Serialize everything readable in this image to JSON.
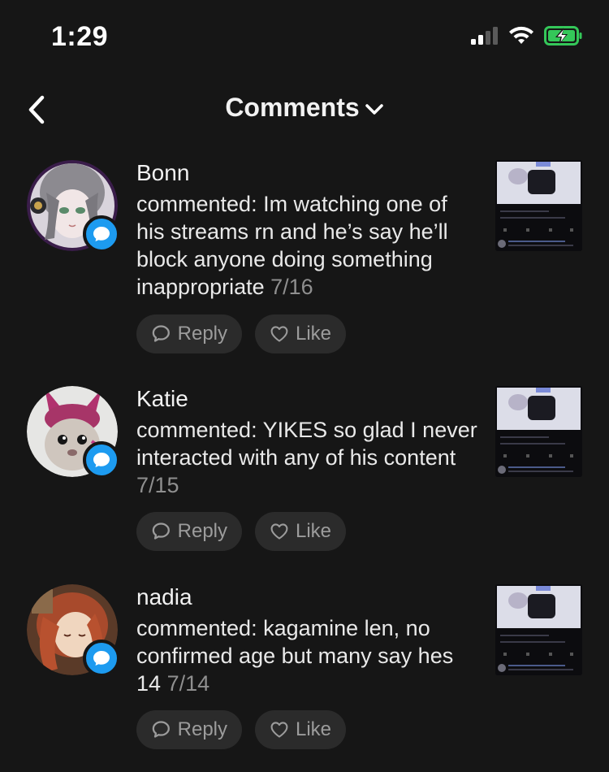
{
  "status_bar": {
    "time": "1:29",
    "icons": [
      "cellular-signal-icon",
      "wifi-icon",
      "battery-charging-icon"
    ],
    "battery_color": "#34c759"
  },
  "header": {
    "back_icon": "chevron-left-icon",
    "title": "Comments",
    "dropdown_icon": "chevron-down-icon"
  },
  "comments": [
    {
      "name": "Bonn",
      "text": "commented: Im watching one of his streams rn and he’s say he’ll block anyone doing something inappropriate",
      "date": "7/16",
      "reply_label": "Reply",
      "like_label": "Like"
    },
    {
      "name": "Katie",
      "text": "commented: YIKES so glad I never interacted with any of his content",
      "date": "7/15",
      "reply_label": "Reply",
      "like_label": "Like"
    },
    {
      "name": "nadia",
      "text": "commented: kagamine len, no confirmed age but many say hes 14",
      "date": "7/14",
      "reply_label": "Reply",
      "like_label": "Like"
    }
  ],
  "colors": {
    "background": "#161616",
    "badge": "#1d9bf0",
    "pill": "#2b2b2b",
    "muted_text": "#8f8f8f"
  }
}
